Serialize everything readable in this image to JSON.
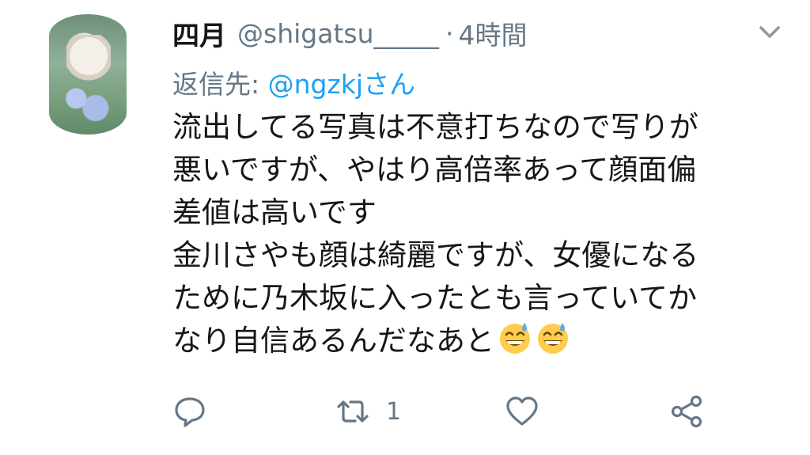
{
  "tweet": {
    "display_name": "四月",
    "handle": "@shigatsu_____",
    "separator": "·",
    "time": "4時間",
    "reply_prefix": "返信先: ",
    "reply_mention": "@ngzkjさん",
    "lines": [
      "流出してる写真は不意打ちなので写りが",
      "悪いですが、やはり高倍率あって顔面偏",
      "差値は高いです",
      "金川さやも顔は綺麗ですが、女優になる",
      "ために乃木坂に入ったとも言っていてか",
      "なり自信あるんだなあと"
    ],
    "trailing_emoji": [
      "grinning-sweat-emoji",
      "grinning-sweat-emoji"
    ]
  },
  "actions": {
    "reply_icon": "reply-icon",
    "retweet_icon": "retweet-icon",
    "retweet_count": "1",
    "like_icon": "heart-icon",
    "share_icon": "share-icon"
  },
  "colors": {
    "text": "#14171a",
    "muted": "#657786",
    "link": "#1da1f2",
    "emoji_face": "#ffcc4d",
    "emoji_sweat": "#5dadec"
  }
}
